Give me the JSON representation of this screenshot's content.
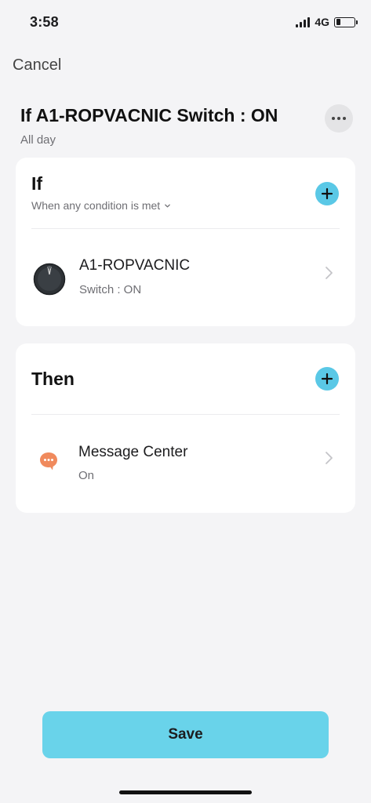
{
  "status_bar": {
    "time": "3:58",
    "network": "4G",
    "battery_level": 0.25
  },
  "header": {
    "cancel_label": "Cancel",
    "title": "If A1-ROPVACNIC Switch : ON",
    "subtitle": "All day",
    "more_icon": "ellipsis-icon"
  },
  "if_section": {
    "title": "If",
    "condition_mode": "When any condition is met",
    "conditions": [
      {
        "device": "A1-ROPVACNIC",
        "state": "Switch : ON",
        "icon": "robot-vacuum-icon"
      }
    ]
  },
  "then_section": {
    "title": "Then",
    "actions": [
      {
        "name": "Message Center",
        "state": "On",
        "icon": "message-bubble-icon"
      }
    ]
  },
  "save_label": "Save",
  "colors": {
    "accent": "#5ac8e6",
    "save_button": "#69d3ea",
    "message_icon": "#f08a5d",
    "background": "#f4f4f6"
  }
}
